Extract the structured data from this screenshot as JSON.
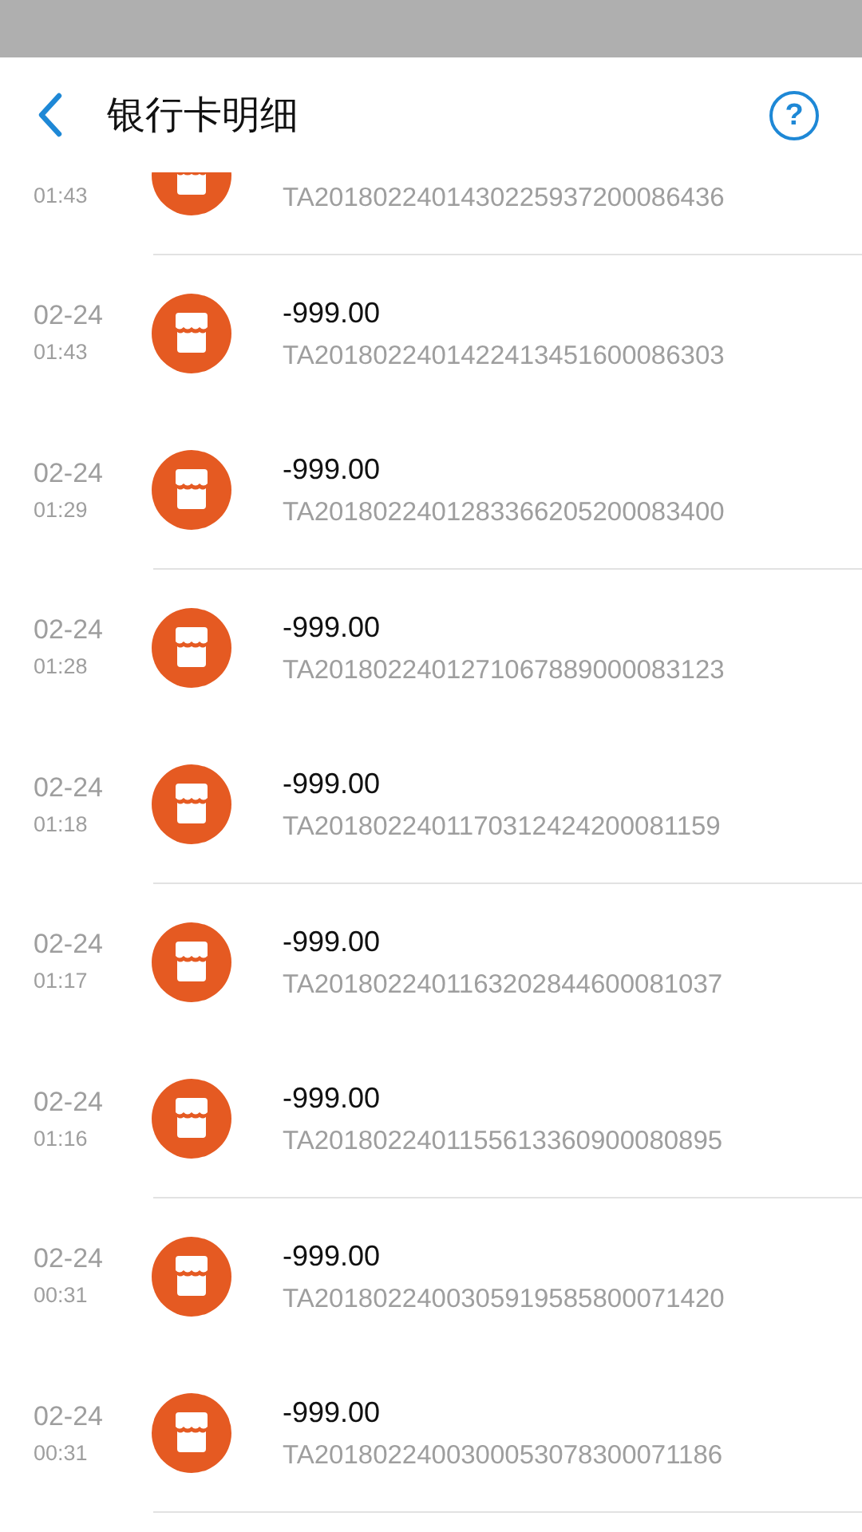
{
  "header": {
    "title": "银行卡明细",
    "help_label": "?"
  },
  "transactions": [
    {
      "time": "01:43",
      "reference": "TA2018022401430225937200086436",
      "divider": true
    },
    {
      "date": "02-24",
      "time": "01:43",
      "amount": "-999.00",
      "reference": "TA2018022401422413451600086303",
      "divider": false
    },
    {
      "date": "02-24",
      "time": "01:29",
      "amount": "-999.00",
      "reference": "TA2018022401283366205200083400",
      "divider": true
    },
    {
      "date": "02-24",
      "time": "01:28",
      "amount": "-999.00",
      "reference": "TA2018022401271067889000083123",
      "divider": false
    },
    {
      "date": "02-24",
      "time": "01:18",
      "amount": "-999.00",
      "reference": "TA2018022401170312424200081159",
      "divider": true
    },
    {
      "date": "02-24",
      "time": "01:17",
      "amount": "-999.00",
      "reference": "TA2018022401163202844600081037",
      "divider": false
    },
    {
      "date": "02-24",
      "time": "01:16",
      "amount": "-999.00",
      "reference": "TA2018022401155613360900080895",
      "divider": true
    },
    {
      "date": "02-24",
      "time": "00:31",
      "amount": "-999.00",
      "reference": "TA2018022400305919585800071420",
      "divider": false
    },
    {
      "date": "02-24",
      "time": "00:31",
      "amount": "-999.00",
      "reference": "TA2018022400300053078300071186",
      "divider": true
    }
  ]
}
